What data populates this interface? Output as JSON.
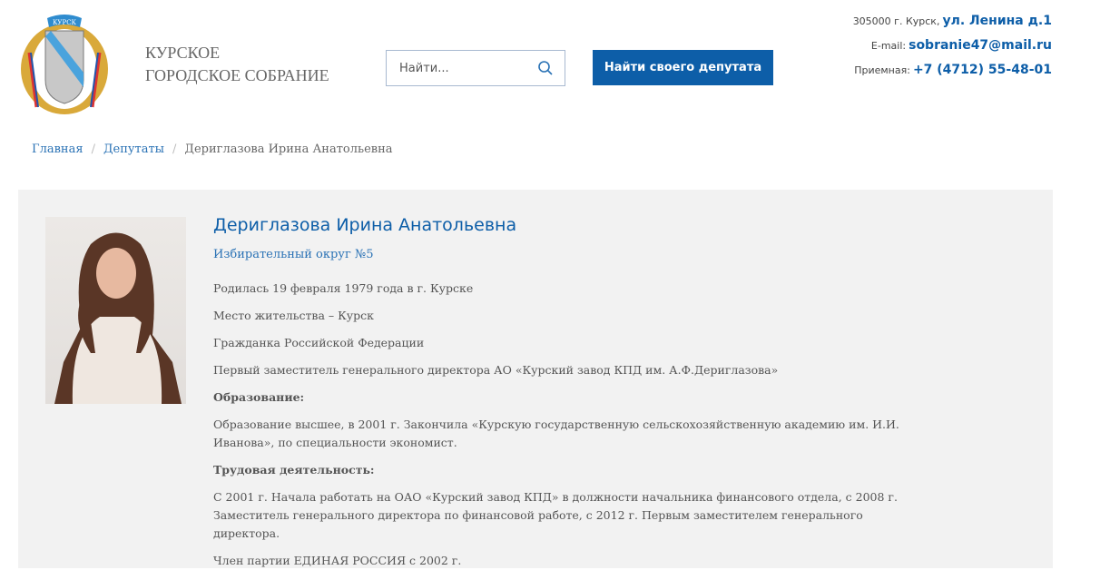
{
  "header": {
    "logo_text": "КУРСК",
    "org_line1": "КУРСКОЕ",
    "org_line2": "ГОРОДСКОЕ СОБРАНИЕ",
    "search_placeholder": "Найти...",
    "find_button": "Найти своего депутата",
    "address_label": "305000 г. Курск,",
    "address_value": "ул. Ленина д.1",
    "email_label": "E-mail:",
    "email_value": "sobranie47@mail.ru",
    "phone_label": "Приемная:",
    "phone_value": "+7 (4712) 55-48-01"
  },
  "breadcrumb": {
    "items": [
      "Главная",
      "Депутаты"
    ],
    "current": "Дериглазова Ирина Анатольевна"
  },
  "deputy": {
    "name": "Дериглазова Ирина Анатольевна",
    "district": "Избирательный округ №5",
    "paragraphs": [
      "Родилась 19 февраля 1979 года в г. Курске",
      "Место жительства – Курск",
      "Гражданка Российской Федерации",
      "Первый заместитель генерального  директора АО «Курский завод КПД им. А.Ф.Дериглазова»"
    ],
    "education_heading": "Образование:",
    "education_text": "Образование высшее, в 2001 г. Закончила «Курскую государственную сельскохозяйственную академию им. И.И. Иванова», по специальности экономист.",
    "work_heading": "Трудовая деятельность:",
    "work_text": "С 2001 г. Начала работать на ОАО «Курский завод КПД»  в должности начальника финансового отдела, с 2008 г. Заместитель генерального директора по финансовой работе, с 2012 г. Первым заместителем генерального директора.",
    "party": "Член партии ЕДИНАЯ РОССИЯ с 2002 г."
  }
}
